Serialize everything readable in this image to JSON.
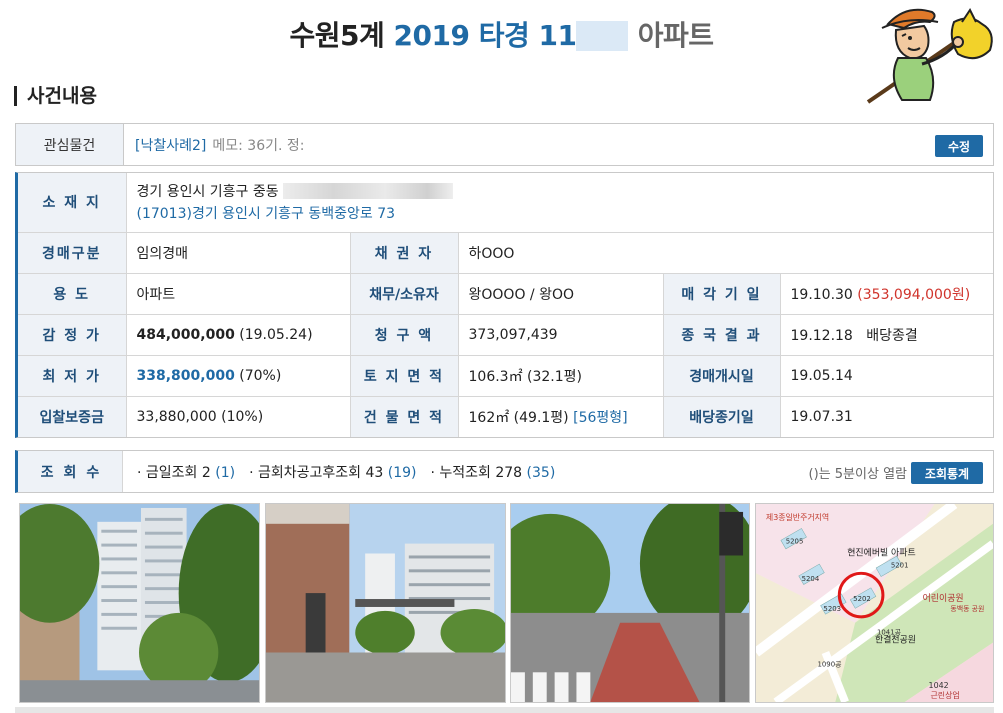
{
  "header": {
    "title_part1": "수원5계",
    "title_part2": "2019 타경 11",
    "title_part3": "아파트"
  },
  "section": {
    "title": "사건내용"
  },
  "memo": {
    "label": "관심물건",
    "link": "[낙찰사례2]",
    "text": "메모: 36기. 정:",
    "edit_button": "수정"
  },
  "info": {
    "location_label": "소 재 지",
    "address_line1": "경기 용인시 기흥구 중동",
    "address_line2": "(17013)경기 용인시 기흥구  동백중앙로  73",
    "auction_type_label": "경매구분",
    "auction_type": "임의경매",
    "creditor_label": "채 권 자",
    "creditor": "하OOO",
    "use_label": "용      도",
    "use": "아파트",
    "debtor_label": "채무/소유자",
    "debtor": "왕OOOO / 왕OO",
    "sale_date_label": "매 각 기 일",
    "sale_date": "19.10.30",
    "sale_price": "(353,094,000원)",
    "appraisal_label": "감 정 가",
    "appraisal_value": "484,000,000",
    "appraisal_date": "(19.05.24)",
    "claim_label": "청 구 액",
    "claim": "373,097,439",
    "final_label": "종 국 결 과",
    "final_date": "19.12.18",
    "final_result": "배당종결",
    "min_price_label": "최 저 가",
    "min_price": "338,800,000",
    "min_price_pct": "(70%)",
    "land_area_label": "토 지 면 적",
    "land_area": "106.3㎡ (32.1평)",
    "start_date_label": "경매개시일",
    "start_date": "19.05.14",
    "deposit_label": "입찰보증금",
    "deposit": "33,880,000 (10%)",
    "building_area_label": "건 물 면 적",
    "building_area": "162㎡ (49.1평)",
    "building_type": "[56평형]",
    "dividend_deadline_label": "배당종기일",
    "dividend_deadline": "19.07.31"
  },
  "views": {
    "label": "조회수",
    "today_label": "· 금일조회 2",
    "today_paren": "(1)",
    "after_label": "· 금회차공고후조회 43",
    "after_paren": "(19)",
    "total_label": "· 누적조회 278",
    "total_paren": "(35)",
    "note": "()는 5분이상 열람",
    "stats_button": "조회통계"
  },
  "map": {
    "label1": "제3종일반주거지역",
    "label2": "현진에버빌 아파트",
    "label3": "어린이공원",
    "label4": "동백동 공원",
    "label5": "한결천공원",
    "label6": "근린상업",
    "num1": "5205",
    "num2": "5204",
    "num3": "5203",
    "num4": "5202",
    "num5": "5201",
    "num6": "1041공",
    "num7": "1090공",
    "num8": "1042"
  },
  "colors": {
    "accent": "#1f6aa5",
    "label_bg": "#eef2f7",
    "price_red": "#d0342c"
  }
}
